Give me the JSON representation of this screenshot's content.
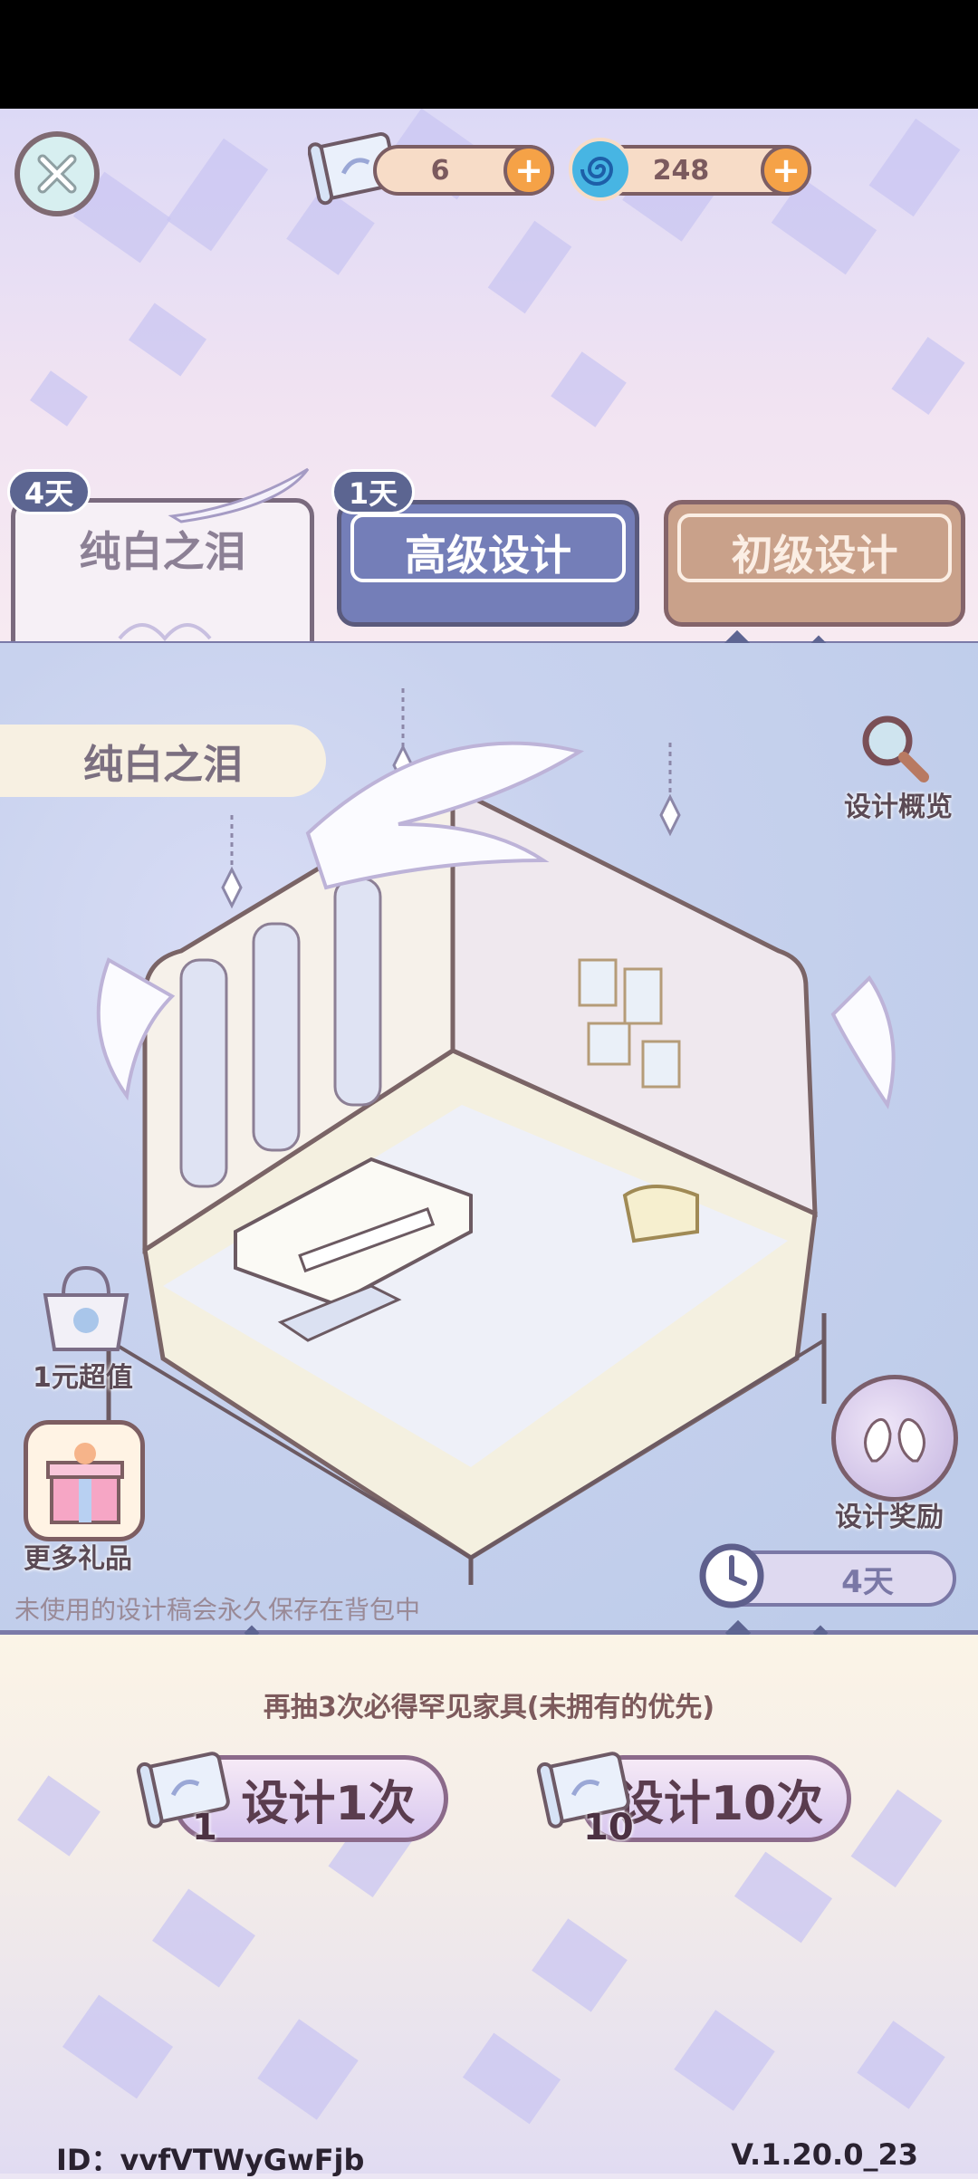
{
  "colors": {
    "accent_orange": "#f5a247",
    "tab_blue": "#747eb8",
    "tab_brown": "#c9a18a",
    "text_dark": "#5a3c4e"
  },
  "header": {
    "close_icon": "close-icon",
    "scroll_currency": {
      "amount": "6",
      "icon": "scroll-icon"
    },
    "swirl_currency": {
      "amount": "248",
      "icon": "swirl-icon"
    }
  },
  "tabs": [
    {
      "label": "纯白之泪",
      "days": "4天"
    },
    {
      "label": "高级设计",
      "days": "1天"
    },
    {
      "label": "初级设计",
      "days": ""
    }
  ],
  "stage": {
    "set_name": "纯白之泪",
    "design_overview": "设计概览",
    "value_offer": "1元超值",
    "more_gifts": "更多礼品",
    "design_reward": "设计奖励",
    "timer": "4天",
    "notice": "未使用的设计稿会永久保存在背包中"
  },
  "draw": {
    "hint": "再抽3次必得罕见家具(未拥有的优先)",
    "single": {
      "label": "设计1次",
      "cost": "1"
    },
    "ten": {
      "label": "设计10次",
      "cost": "10"
    }
  },
  "footer": {
    "id_text": "ID：vvfVTWyGwFjb",
    "version": "V.1.20.0_23"
  }
}
